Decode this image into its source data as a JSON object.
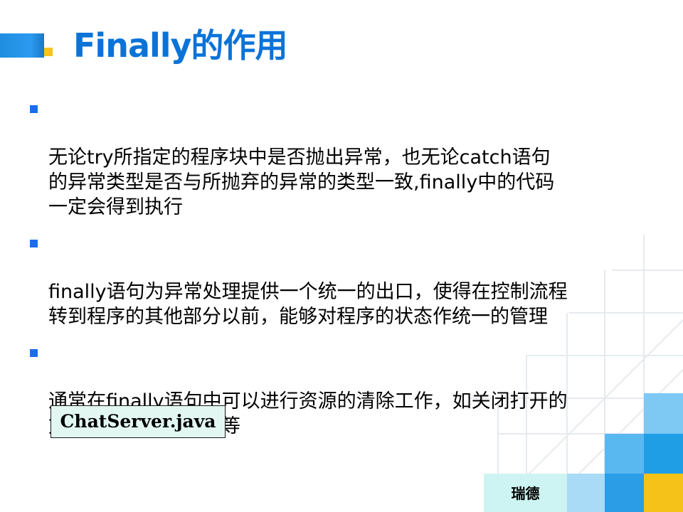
{
  "slide": {
    "title": "Finally的作用",
    "bullets": [
      {
        "text": "无论try所指定的程序块中是否抛出异常，也无论catch语句\n的异常类型是否与所抛弃的异常的类型一致,finally中的代码\n一定会得到执行"
      },
      {
        "text": "finally语句为异常处理提供一个统一的出口，使得在控制流程\n转到程序的其他部分以前，能够对程序的状态作统一的管理"
      },
      {
        "text": "通常在finally语句中可以进行资源的清除工作，如关闭打开的\n文件、删除临时文件等"
      }
    ],
    "file_label": "ChatServer.java",
    "footer": "瑞德"
  },
  "colors": {
    "title": "#0a73d8",
    "bullet_marker": "#1a6ee8",
    "accent_blue": "#1f8ee0",
    "accent_yellow": "#f5c518",
    "file_box_bg": "#e3f7f2",
    "footer_bg": "#cdf4f2"
  }
}
